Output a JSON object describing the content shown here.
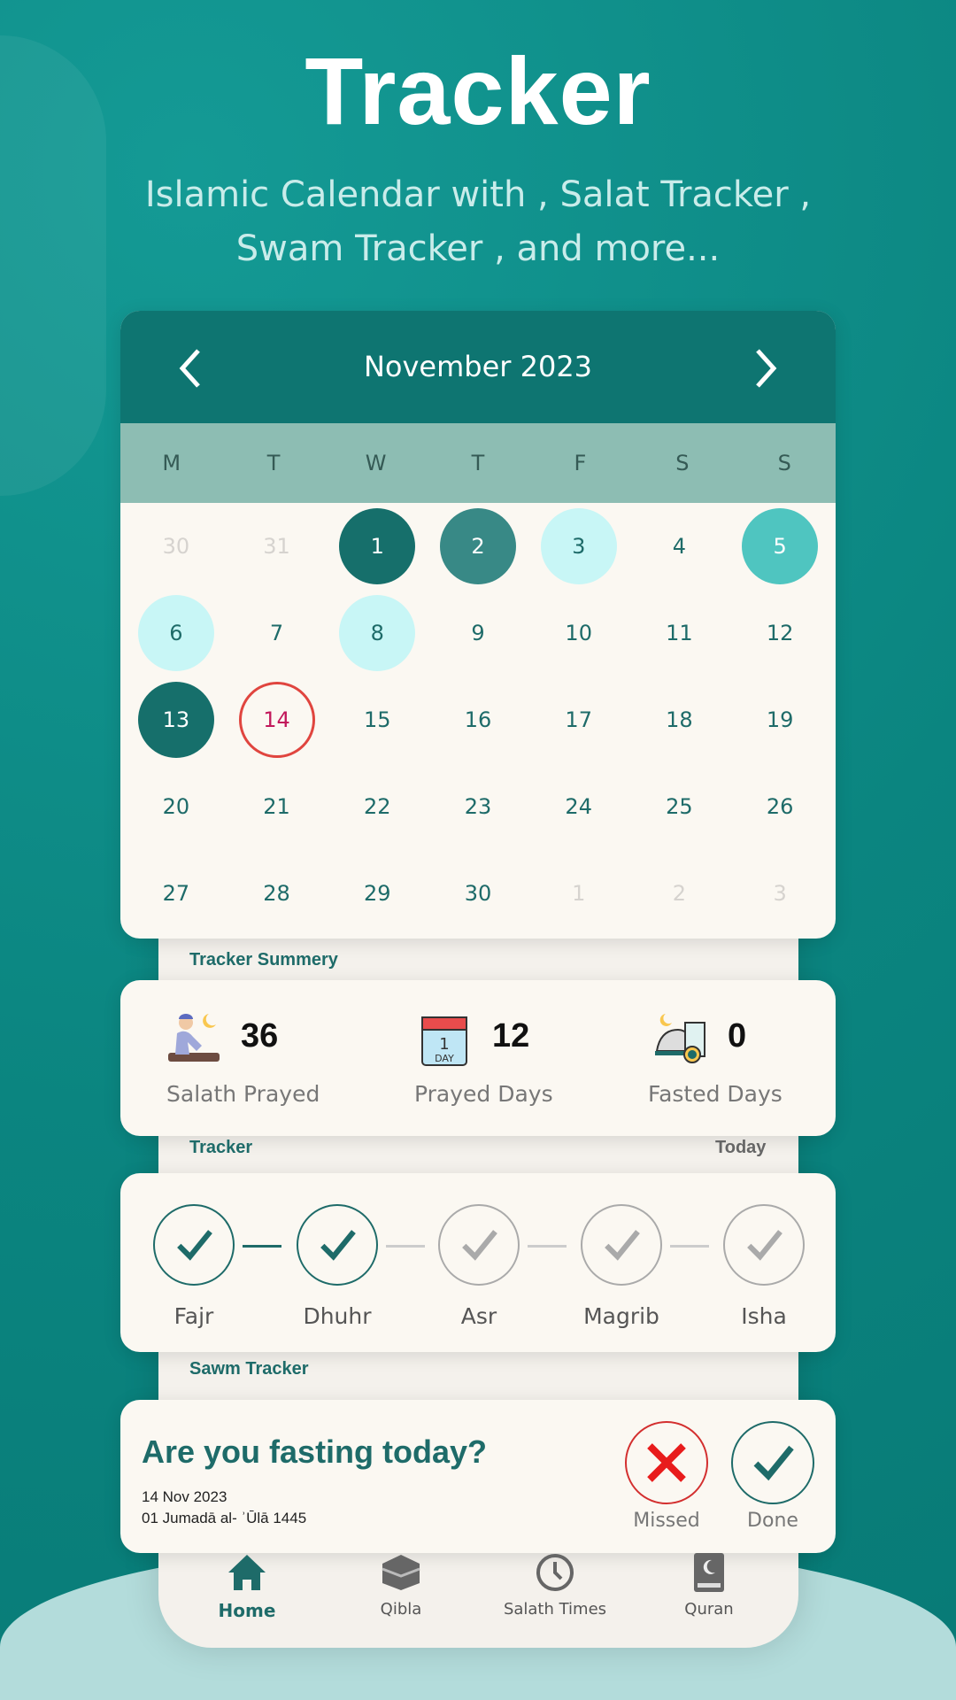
{
  "header": {
    "title": "Tracker",
    "subtitle_line1": "Islamic Calendar with , Salat Tracker ,",
    "subtitle_line2": "Swam Tracker , and more..."
  },
  "calendar": {
    "month_label": "November  2023",
    "weekdays": [
      "M",
      "T",
      "W",
      "T",
      "F",
      "S",
      "S"
    ],
    "days": [
      {
        "n": "30",
        "state": "muted"
      },
      {
        "n": "31",
        "state": "muted"
      },
      {
        "n": "1",
        "state": "dark"
      },
      {
        "n": "2",
        "state": "mid"
      },
      {
        "n": "3",
        "state": "light"
      },
      {
        "n": "4",
        "state": "normal"
      },
      {
        "n": "5",
        "state": "accent"
      },
      {
        "n": "6",
        "state": "light"
      },
      {
        "n": "7",
        "state": "normal"
      },
      {
        "n": "8",
        "state": "light"
      },
      {
        "n": "9",
        "state": "normal"
      },
      {
        "n": "10",
        "state": "normal"
      },
      {
        "n": "11",
        "state": "normal"
      },
      {
        "n": "12",
        "state": "normal"
      },
      {
        "n": "13",
        "state": "dark"
      },
      {
        "n": "14",
        "state": "today"
      },
      {
        "n": "15",
        "state": "normal"
      },
      {
        "n": "16",
        "state": "normal"
      },
      {
        "n": "17",
        "state": "normal"
      },
      {
        "n": "18",
        "state": "normal"
      },
      {
        "n": "19",
        "state": "normal"
      },
      {
        "n": "20",
        "state": "normal"
      },
      {
        "n": "21",
        "state": "normal"
      },
      {
        "n": "22",
        "state": "normal"
      },
      {
        "n": "23",
        "state": "normal"
      },
      {
        "n": "24",
        "state": "normal"
      },
      {
        "n": "25",
        "state": "normal"
      },
      {
        "n": "26",
        "state": "normal"
      },
      {
        "n": "27",
        "state": "normal"
      },
      {
        "n": "28",
        "state": "normal"
      },
      {
        "n": "29",
        "state": "normal"
      },
      {
        "n": "30",
        "state": "normal"
      },
      {
        "n": "1",
        "state": "muted"
      },
      {
        "n": "2",
        "state": "muted"
      },
      {
        "n": "3",
        "state": "muted"
      }
    ]
  },
  "summary": {
    "section_label": "Tracker Summery",
    "stats": [
      {
        "value": "36",
        "label": "Salath Prayed",
        "icon": "praying-person-icon"
      },
      {
        "value": "12",
        "label": "Prayed Days",
        "icon": "calendar-day-icon"
      },
      {
        "value": "0",
        "label": "Fasted Days",
        "icon": "iftar-dish-icon"
      }
    ]
  },
  "tracker": {
    "section_label": "Tracker",
    "today_label": "Today",
    "prayers": [
      {
        "name": "Fajr",
        "done": true
      },
      {
        "name": "Dhuhr",
        "done": true
      },
      {
        "name": "Asr",
        "done": false
      },
      {
        "name": "Magrib",
        "done": false
      },
      {
        "name": "Isha",
        "done": false
      }
    ]
  },
  "sawm": {
    "section_label": "Sawm Tracker",
    "question": "Are you fasting today?",
    "date": "14 Nov 2023",
    "hijri_date": "01 Jumadā al- ʾŪlā 1445",
    "missed_label": "Missed",
    "done_label": "Done"
  },
  "nav": [
    {
      "label": "Home",
      "icon": "home-icon",
      "active": true
    },
    {
      "label": "Qibla",
      "icon": "kaaba-icon",
      "active": false
    },
    {
      "label": "Salath Times",
      "icon": "clock-icon",
      "active": false
    },
    {
      "label": "Quran",
      "icon": "quran-book-icon",
      "active": false
    }
  ],
  "colors": {
    "background": "#0b8580",
    "header": "#0e7571",
    "card": "#fbf8f2",
    "accent": "#1e6b69",
    "today": "#e0453f"
  }
}
